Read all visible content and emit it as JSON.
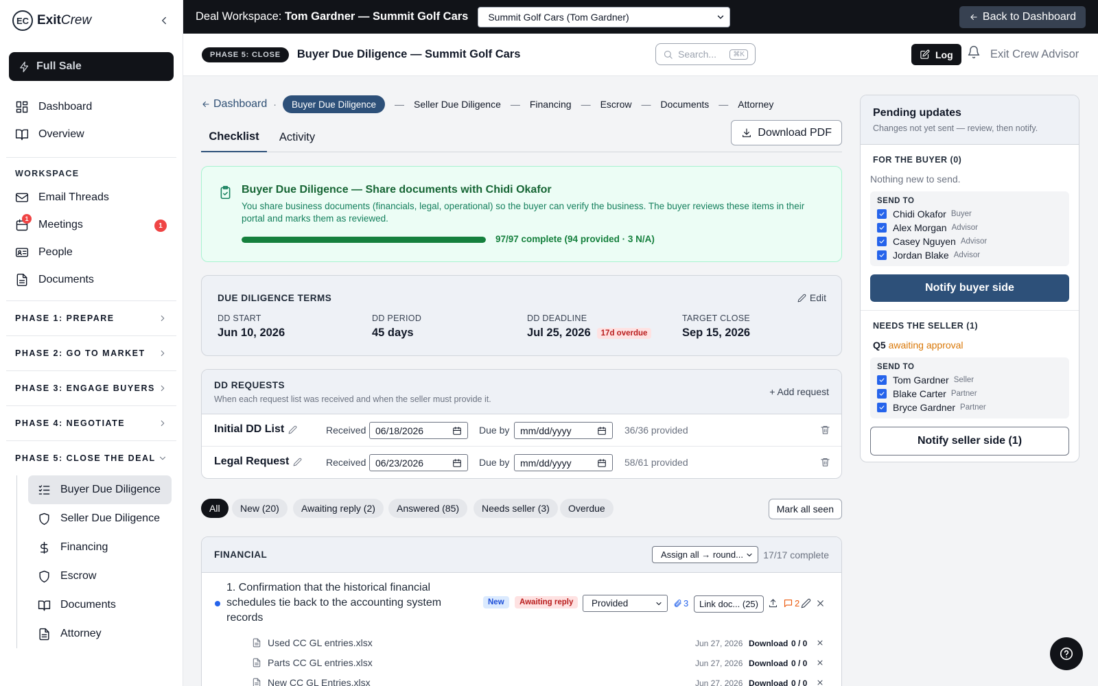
{
  "app": {
    "brand_short": "EC",
    "brand_bold": "Exit",
    "brand_rest": "Crew"
  },
  "sidebar": {
    "mode_label": "Full Sale",
    "top_items": [
      {
        "label": "Dashboard",
        "icon": "grid-icon"
      },
      {
        "label": "Overview",
        "icon": "book-icon"
      }
    ],
    "workspace_label": "WORKSPACE",
    "workspace_items": [
      {
        "label": "Email Threads",
        "icon": "mail-icon"
      },
      {
        "label": "Meetings",
        "icon": "calendar-icon",
        "icon_badge": "1",
        "count_badge": "1"
      },
      {
        "label": "People",
        "icon": "id-card-icon"
      },
      {
        "label": "Documents",
        "icon": "document-icon"
      }
    ],
    "phases": [
      {
        "label": "PHASE 1: PREPARE"
      },
      {
        "label": "PHASE 2: GO TO MARKET"
      },
      {
        "label": "PHASE 3: ENGAGE BUYERS"
      },
      {
        "label": "PHASE 4: NEGOTIATE"
      },
      {
        "label": "PHASE 5: CLOSE THE DEAL"
      }
    ],
    "phase5_items": [
      {
        "label": "Buyer Due Diligence",
        "icon": "checklist-icon",
        "active": true
      },
      {
        "label": "Seller Due Diligence",
        "icon": "shield-icon"
      },
      {
        "label": "Financing",
        "icon": "dollar-icon"
      },
      {
        "label": "Escrow",
        "icon": "shield-icon"
      },
      {
        "label": "Documents",
        "icon": "book-icon"
      },
      {
        "label": "Attorney",
        "icon": "document-icon"
      }
    ]
  },
  "topbar": {
    "title_prefix": "Deal Workspace:",
    "title_deal": "Tom Gardner — Summit Golf Cars",
    "deal_select_value": "Summit Golf Cars (Tom Gardner)",
    "back_label": "Back to Dashboard"
  },
  "header": {
    "phase_pill": "PHASE 5: CLOSE",
    "title": "Buyer Due Diligence — Summit Golf Cars",
    "search_placeholder": "Search...",
    "search_shortcut": "⌘K",
    "log_label": "Log",
    "user_label": "Exit Crew Advisor"
  },
  "breadcrumb": {
    "back_label": "Dashboard",
    "dot": "·",
    "active": "Buyer Due Diligence",
    "separator": "—",
    "steps": [
      "Seller Due Diligence",
      "Financing",
      "Escrow",
      "Documents",
      "Attorney"
    ]
  },
  "tabs": [
    {
      "label": "Checklist",
      "active": true
    },
    {
      "label": "Activity"
    }
  ],
  "download_label": "Download PDF",
  "summary": {
    "title": "Buyer Due Diligence — Share documents with Chidi Okafor",
    "description": "You share business documents (financials, legal, operational) so the buyer can verify the business. The buyer reviews these items in their portal and marks them as reviewed.",
    "progress_fraction": 1.0,
    "progress_text": "97/97 complete (94 provided · 3 N/A)"
  },
  "terms": {
    "title": "DUE DILIGENCE TERMS",
    "edit_label": "Edit",
    "fields": [
      {
        "label": "DD START",
        "value": "Jun 10, 2026"
      },
      {
        "label": "DD PERIOD",
        "value": "45 days"
      },
      {
        "label": "DD DEADLINE",
        "value": "Jul 25, 2026",
        "badge": "17d overdue"
      },
      {
        "label": "TARGET CLOSE",
        "value": "Sep 15, 2026"
      }
    ]
  },
  "requests": {
    "title": "DD REQUESTS",
    "subtitle": "When each request list was received and when the seller must provide it.",
    "add_label": "+ Add request",
    "received_label": "Received",
    "due_label": "Due by",
    "rows": [
      {
        "name": "Initial DD List",
        "received": "06/18/2026",
        "due": "mm/dd/yyyy",
        "status": "36/36 provided"
      },
      {
        "name": "Legal Request",
        "received": "06/23/2026",
        "due": "mm/dd/yyyy",
        "status": "58/61 provided"
      }
    ]
  },
  "filters": {
    "chips": [
      "All",
      "New (20)",
      "Awaiting reply (2)",
      "Answered (85)",
      "Needs seller (3)",
      "Overdue"
    ],
    "mark_all_label": "Mark all seen"
  },
  "financial": {
    "title": "FINANCIAL",
    "assign_value": "Assign all → round...",
    "count": "17/17 complete",
    "item": {
      "number": "1.",
      "text": "Confirmation that the historical financial schedules tie back to the accounting system records",
      "new_label": "New",
      "await_label": "Awaiting reply",
      "status_value": "Provided",
      "attach_count": "3",
      "link_label": "Link doc... (25)",
      "comment_count": "2"
    },
    "files": [
      {
        "name": "Used CC GL entries.xlsx",
        "date": "Jun 27, 2026",
        "action": "Download",
        "count": "0 / 0"
      },
      {
        "name": "Parts CC GL entries.xlsx",
        "date": "Jun 27, 2026",
        "action": "Download",
        "count": "0 / 0"
      },
      {
        "name": "New CC GL Entries.xlsx",
        "date": "Jun 27, 2026",
        "action": "Download",
        "count": "0 / 0"
      }
    ]
  },
  "pending": {
    "title": "Pending updates",
    "subtitle": "Changes not yet sent — review, then notify.",
    "buyer": {
      "title": "FOR THE BUYER (0)",
      "note": "Nothing new to send.",
      "send_to_label": "SEND TO",
      "recipients": [
        {
          "name": "Chidi Okafor",
          "role": "Buyer"
        },
        {
          "name": "Alex Morgan",
          "role": "Advisor"
        },
        {
          "name": "Casey Nguyen",
          "role": "Advisor"
        },
        {
          "name": "Jordan Blake",
          "role": "Advisor"
        }
      ],
      "button": "Notify buyer side"
    },
    "seller": {
      "title": "NEEDS THE SELLER (1)",
      "q_label": "Q5",
      "q_status": "awaiting approval",
      "send_to_label": "SEND TO",
      "recipients": [
        {
          "name": "Tom Gardner",
          "role": "Seller"
        },
        {
          "name": "Blake Carter",
          "role": "Partner"
        },
        {
          "name": "Bryce Gardner",
          "role": "Partner"
        }
      ],
      "button": "Notify seller side (1)"
    }
  }
}
